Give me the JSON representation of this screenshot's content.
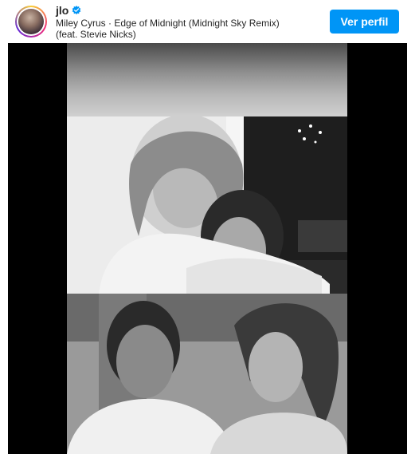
{
  "header": {
    "username": "jlo",
    "verified": true,
    "song": "Miley Cyrus · Edge of Midnight (Midnight Sky Remix) (feat. Stevie Nicks)",
    "cta_label": "Ver perfil"
  },
  "colors": {
    "accent": "#0095f6",
    "text": "#262626",
    "media_background": "#000000"
  },
  "icons": {
    "verified": "verified-badge-icon"
  },
  "media": {
    "type": "photo-collage",
    "panels": [
      "photo-1",
      "photo-2",
      "photo-3"
    ]
  }
}
